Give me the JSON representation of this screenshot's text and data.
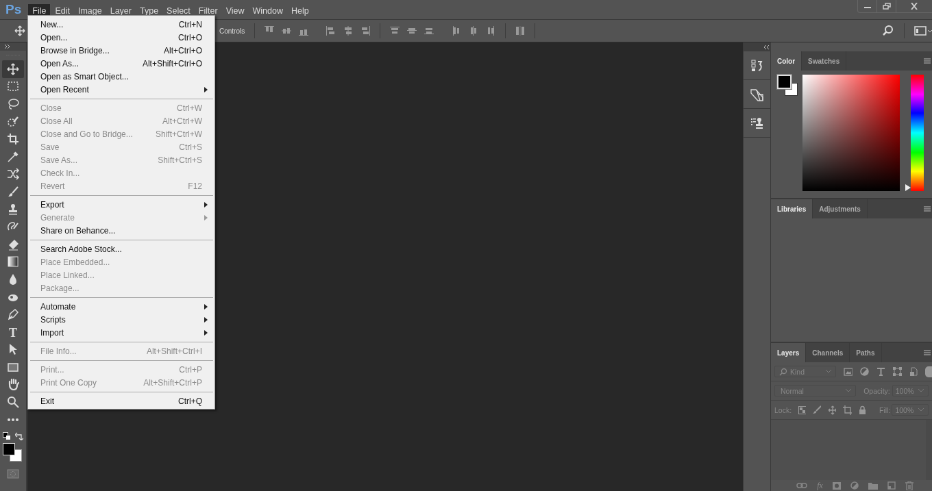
{
  "menubar": {
    "logo": "Ps",
    "menus": [
      {
        "label": "File",
        "selected": true
      },
      {
        "label": "Edit",
        "selected": false
      },
      {
        "label": "Image",
        "selected": false
      },
      {
        "label": "Layer",
        "selected": false
      },
      {
        "label": "Type",
        "selected": false
      },
      {
        "label": "Select",
        "selected": false
      },
      {
        "label": "Filter",
        "selected": false
      },
      {
        "label": "View",
        "selected": false
      },
      {
        "label": "Window",
        "selected": false
      },
      {
        "label": "Help",
        "selected": false
      }
    ]
  },
  "options_bar": {
    "label": "Controls"
  },
  "file_menu": {
    "items": [
      {
        "kind": "item",
        "label": "New...",
        "shortcut": "Ctrl+N",
        "disabled": false,
        "submenu": false
      },
      {
        "kind": "item",
        "label": "Open...",
        "shortcut": "Ctrl+O",
        "disabled": false,
        "submenu": false
      },
      {
        "kind": "item",
        "label": "Browse in Bridge...",
        "shortcut": "Alt+Ctrl+O",
        "disabled": false,
        "submenu": false
      },
      {
        "kind": "item",
        "label": "Open As...",
        "shortcut": "Alt+Shift+Ctrl+O",
        "disabled": false,
        "submenu": false
      },
      {
        "kind": "item",
        "label": "Open as Smart Object...",
        "disabled": false,
        "submenu": false
      },
      {
        "kind": "item",
        "label": "Open Recent",
        "disabled": false,
        "submenu": true
      },
      {
        "kind": "separator"
      },
      {
        "kind": "item",
        "label": "Close",
        "shortcut": "Ctrl+W",
        "disabled": true,
        "submenu": false
      },
      {
        "kind": "item",
        "label": "Close All",
        "shortcut": "Alt+Ctrl+W",
        "disabled": true,
        "submenu": false
      },
      {
        "kind": "item",
        "label": "Close and Go to Bridge...",
        "shortcut": "Shift+Ctrl+W",
        "disabled": true,
        "submenu": false
      },
      {
        "kind": "item",
        "label": "Save",
        "shortcut": "Ctrl+S",
        "disabled": true,
        "submenu": false
      },
      {
        "kind": "item",
        "label": "Save As...",
        "shortcut": "Shift+Ctrl+S",
        "disabled": true,
        "submenu": false
      },
      {
        "kind": "item",
        "label": "Check In...",
        "disabled": true,
        "submenu": false
      },
      {
        "kind": "item",
        "label": "Revert",
        "shortcut": "F12",
        "disabled": true,
        "submenu": false
      },
      {
        "kind": "separator"
      },
      {
        "kind": "item",
        "label": "Export",
        "disabled": false,
        "submenu": true
      },
      {
        "kind": "item",
        "label": "Generate",
        "disabled": true,
        "submenu": true
      },
      {
        "kind": "item",
        "label": "Share on Behance...",
        "disabled": false,
        "submenu": false
      },
      {
        "kind": "separator"
      },
      {
        "kind": "item",
        "label": "Search Adobe Stock...",
        "disabled": false,
        "submenu": false
      },
      {
        "kind": "item",
        "label": "Place Embedded...",
        "disabled": true,
        "submenu": false
      },
      {
        "kind": "item",
        "label": "Place Linked...",
        "disabled": true,
        "submenu": false
      },
      {
        "kind": "item",
        "label": "Package...",
        "disabled": true,
        "submenu": false
      },
      {
        "kind": "separator"
      },
      {
        "kind": "item",
        "label": "Automate",
        "disabled": false,
        "submenu": true
      },
      {
        "kind": "item",
        "label": "Scripts",
        "disabled": false,
        "submenu": true
      },
      {
        "kind": "item",
        "label": "Import",
        "disabled": false,
        "submenu": true
      },
      {
        "kind": "separator"
      },
      {
        "kind": "item",
        "label": "File Info...",
        "shortcut": "Alt+Shift+Ctrl+I",
        "disabled": true,
        "submenu": false
      },
      {
        "kind": "separator"
      },
      {
        "kind": "item",
        "label": "Print...",
        "shortcut": "Ctrl+P",
        "disabled": true,
        "submenu": false
      },
      {
        "kind": "item",
        "label": "Print One Copy",
        "shortcut": "Alt+Shift+Ctrl+P",
        "disabled": true,
        "submenu": false
      },
      {
        "kind": "separator"
      },
      {
        "kind": "item",
        "label": "Exit",
        "shortcut": "Ctrl+Q",
        "disabled": false,
        "submenu": false
      }
    ]
  },
  "tools": [
    {
      "kind": "move",
      "selected": true
    },
    {
      "kind": "marquee",
      "selected": false
    },
    {
      "kind": "lasso",
      "selected": false
    },
    {
      "kind": "quick-select",
      "selected": false
    },
    {
      "kind": "crop",
      "selected": false
    },
    {
      "kind": "eyedropper",
      "selected": false
    },
    {
      "kind": "content-move",
      "selected": false
    },
    {
      "kind": "brush",
      "selected": false
    },
    {
      "kind": "stamp",
      "selected": false
    },
    {
      "kind": "history-brush",
      "selected": false
    },
    {
      "kind": "eraser",
      "selected": false
    },
    {
      "kind": "gradient",
      "selected": false
    },
    {
      "kind": "blur",
      "selected": false
    },
    {
      "kind": "dodge",
      "selected": false
    },
    {
      "kind": "pen",
      "selected": false
    },
    {
      "kind": "type",
      "selected": false
    },
    {
      "kind": "path-select",
      "selected": false
    },
    {
      "kind": "rectangle",
      "selected": false
    },
    {
      "kind": "hand",
      "selected": false
    },
    {
      "kind": "zoom",
      "selected": false
    },
    {
      "kind": "more",
      "selected": false
    }
  ],
  "type_tool_label": "T",
  "color_panel": {
    "hue_slider": {
      "level": 0
    },
    "tabs": [
      {
        "label": "Color",
        "selected": true
      },
      {
        "label": "Swatches",
        "selected": false
      }
    ]
  },
  "libraries_panel": {
    "tabs": [
      {
        "label": "Libraries",
        "selected": true
      },
      {
        "label": "Adjustments",
        "selected": false
      }
    ]
  },
  "layers_panel": {
    "tabs": [
      {
        "label": "Layers",
        "selected": true
      },
      {
        "label": "Channels",
        "selected": false
      },
      {
        "label": "Paths",
        "selected": false
      }
    ],
    "filter": "Kind",
    "blend_mode": "Normal",
    "opacity_label": "Opacity:",
    "opacity": "100%",
    "lock_label": "Lock:",
    "fill_label": "Fill:",
    "fill": "100%",
    "fx_label": "fx"
  }
}
